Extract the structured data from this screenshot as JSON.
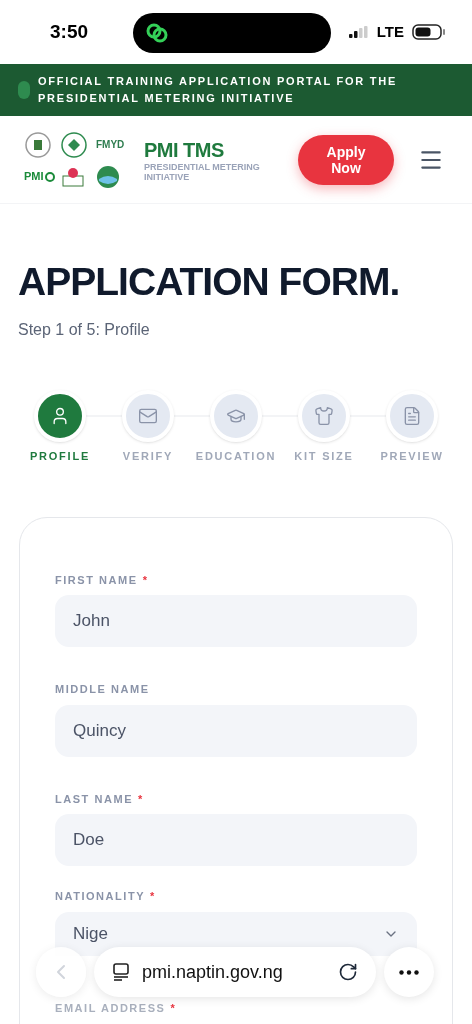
{
  "status_bar": {
    "time": "3:50",
    "network": "LTE"
  },
  "banner": {
    "text": "OFFICIAL TRAINING APPLICATION PORTAL FOR THE PRESIDENTIAL METERING INITIATIVE"
  },
  "header": {
    "logo_texts": [
      "FMYD",
      "PMI"
    ],
    "title": "PMI TMS",
    "subtitle": "PRESIDENTIAL METERING INITIATIVE",
    "apply_button": "Apply Now"
  },
  "page": {
    "title": "APPLICATION FORM.",
    "step": "Step 1 of 5: Profile"
  },
  "steps": [
    {
      "label": "PROFILE",
      "selected": true
    },
    {
      "label": "VERIFY",
      "selected": false
    },
    {
      "label": "EDUCATION",
      "selected": false
    },
    {
      "label": "KIT SIZE",
      "selected": false
    },
    {
      "label": "PREVIEW",
      "selected": false
    }
  ],
  "fields": [
    {
      "label": "FIRST NAME",
      "required_mark": "*",
      "value": "John"
    },
    {
      "label": "MIDDLE NAME",
      "value": "Quincy"
    },
    {
      "label": "LAST NAME",
      "required_mark": "*",
      "value": "Doe"
    },
    {
      "label": "NATIONALITY",
      "required_mark": "*",
      "value": "Nige"
    },
    {
      "label": "EMAIL ADDRESS",
      "required_mark": "*"
    }
  ],
  "browser_bar": {
    "url": "pmi.naptin.gov.ng"
  }
}
